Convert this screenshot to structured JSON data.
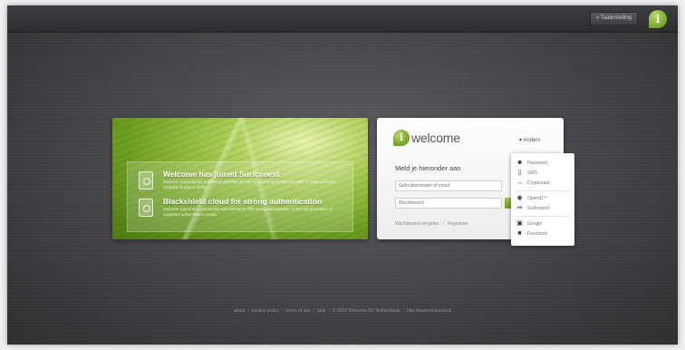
{
  "header": {
    "language_button": "« Taalinstelling",
    "logo_letter": "i"
  },
  "promo": {
    "features": [
      {
        "title": "Welcome has joined Surfconext",
        "description": "Welcome now supports Surfconext. Whether you feel to access Surfconext yourself, or make sure your institution is able to further."
      },
      {
        "title": "Blackshield cloud for strong authentication",
        "description": "Welcome signed up a partnership with Safenet to offer strong authentication in the new generation of supported authentication media."
      }
    ]
  },
  "login": {
    "brand_letter": "i",
    "brand_name": "welcome",
    "other_toggle": "▾ Anders",
    "heading": "Meld je hieronder aan",
    "username_placeholder": "Gebruikersnaam of email",
    "password_placeholder": "Wachtwoord",
    "forgot_link": "Wachtwoord vergeten",
    "register_link": "Registreer"
  },
  "methods_dropdown": {
    "items": [
      {
        "label": "Password",
        "icon": "person-icon"
      },
      {
        "label": "SMS",
        "icon": "phone-icon"
      },
      {
        "label": "Cryptocard",
        "icon": "key-icon"
      },
      {
        "label": "OpenID™",
        "icon": "openid-icon"
      },
      {
        "label": "Surfconext",
        "icon": "surfconext-icon"
      },
      {
        "label": "Google",
        "icon": "google-icon"
      },
      {
        "label": "Facebook",
        "icon": "facebook-icon"
      }
    ]
  },
  "footer": {
    "links": [
      "about",
      "privacy-policy",
      "terms of use",
      "help",
      "© 2012 Welcome.BV Netherlands",
      "http://www.welcome.nl"
    ]
  },
  "colors": {
    "brand_green": "#76a92a",
    "background": "#48494c",
    "card": "#ffffff"
  }
}
